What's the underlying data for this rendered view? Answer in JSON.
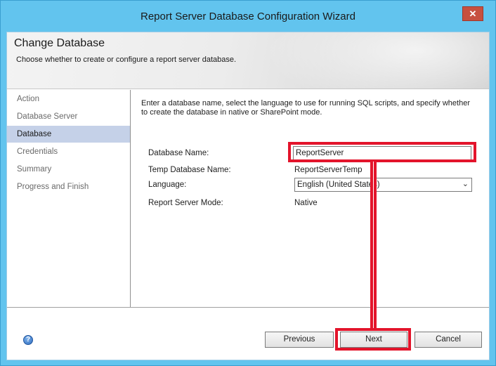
{
  "window": {
    "title": "Report Server Database Configuration Wizard",
    "close_label": "✕"
  },
  "header": {
    "title": "Change Database",
    "subtitle": "Choose whether to create or configure a report server database."
  },
  "sidebar": {
    "items": [
      {
        "label": "Action",
        "active": false
      },
      {
        "label": "Database Server",
        "active": false
      },
      {
        "label": "Database",
        "active": true
      },
      {
        "label": "Credentials",
        "active": false
      },
      {
        "label": "Summary",
        "active": false
      },
      {
        "label": "Progress and Finish",
        "active": false
      }
    ]
  },
  "main": {
    "intro": "Enter a database name, select the language to use for running SQL scripts, and specify whether to create the database in native or SharePoint mode.",
    "db_name_label": "Database Name:",
    "db_name_value": "ReportServer",
    "temp_db_label": "Temp Database Name:",
    "temp_db_value": "ReportServerTemp",
    "language_label": "Language:",
    "language_value": "English (United States)",
    "mode_label": "Report Server Mode:",
    "mode_value": "Native"
  },
  "footer": {
    "help_glyph": "?",
    "previous_label": "Previous",
    "next_label": "Next",
    "cancel_label": "Cancel"
  },
  "colors": {
    "titlebar": "#62c4ee",
    "highlight": "#e3142b",
    "active_step": "#c5d1e8",
    "close_button": "#c7503f"
  }
}
